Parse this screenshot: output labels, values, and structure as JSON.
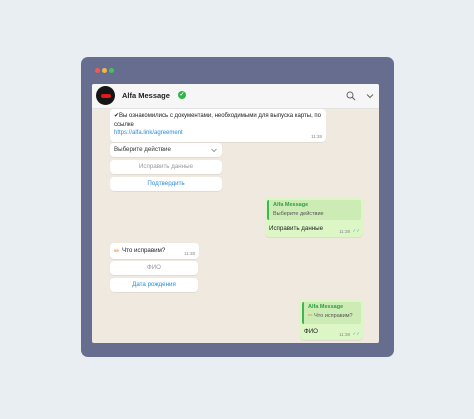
{
  "header": {
    "title": "Alfa Message",
    "verified_mark": "✓"
  },
  "messages": {
    "m1": {
      "text": "✔Вы ознакомились с документами, необходимыми для выпуска карты, по ссылке",
      "link": "https://alfa.link/agreement",
      "time": "11:38"
    },
    "m1_select": {
      "label": "Выберите действие"
    },
    "m1_buttons": {
      "edit": "Исправить данные",
      "confirm": "Подтвердить"
    },
    "m2": {
      "quote_title": "Alfa Message",
      "quote_text": "Выберите действие",
      "text": "Исправить данные",
      "time": "11:38",
      "ticks": "✓✓"
    },
    "m3": {
      "emoji": "✏",
      "text": "Что исправим?",
      "time": "11:38"
    },
    "m3_buttons": {
      "fio": "ФИО",
      "dob": "Дата рождения"
    },
    "m4": {
      "quote_title": "Alfa Message",
      "quote_emoji": "✏",
      "quote_text": "Что исправим?",
      "text": "ФИО",
      "time": "11:38",
      "ticks": "✓✓"
    }
  },
  "colors": {
    "background": "#e9eef3",
    "window": "#676d8f",
    "chat_bg": "#efe9e0",
    "outgoing": "#dcf7c5",
    "link": "#2d8bd8",
    "accent_green": "#2fb649",
    "brand_red": "#e21a1a"
  }
}
